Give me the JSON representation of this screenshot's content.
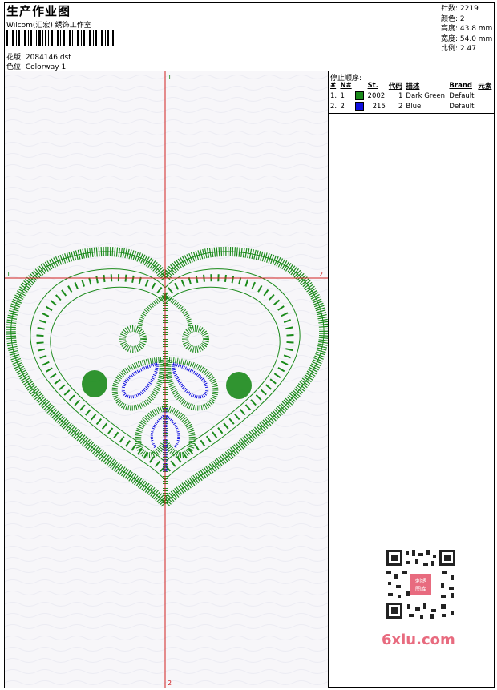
{
  "header": {
    "title": "生产作业图",
    "subtitle": "Wilcom(汇宏) 绣饰工作室",
    "design_label": "花版: 2084146.dst",
    "colorway_label": "色位: Colorway 1"
  },
  "stats": {
    "stitches": "针数: 2219",
    "colors": "颜色: 2",
    "height": "高度: 43.8 mm",
    "width": "宽度: 54.0 mm",
    "scale": "比例: 2.47"
  },
  "axes": {
    "top_label": "1",
    "left_label": "1",
    "right_label": "2",
    "bottom_label": "2"
  },
  "stop_sequence": {
    "title": "停止顺序:",
    "columns": [
      "#",
      "N#",
      "St.",
      "代码",
      "描述",
      "Brand",
      "元素"
    ],
    "rows": [
      {
        "index": "1.",
        "n": "1",
        "color": "#1a8a1a",
        "code": "2002",
        "st": "1",
        "desc": "Dark Green",
        "brand": "Default"
      },
      {
        "index": "2.",
        "n": "2",
        "color": "#1010e0",
        "code": "215",
        "st": "2",
        "desc": "Blue",
        "brand": "Default"
      }
    ]
  },
  "watermark": {
    "site": "6xiu.com",
    "stamp": "刺绣图库"
  }
}
